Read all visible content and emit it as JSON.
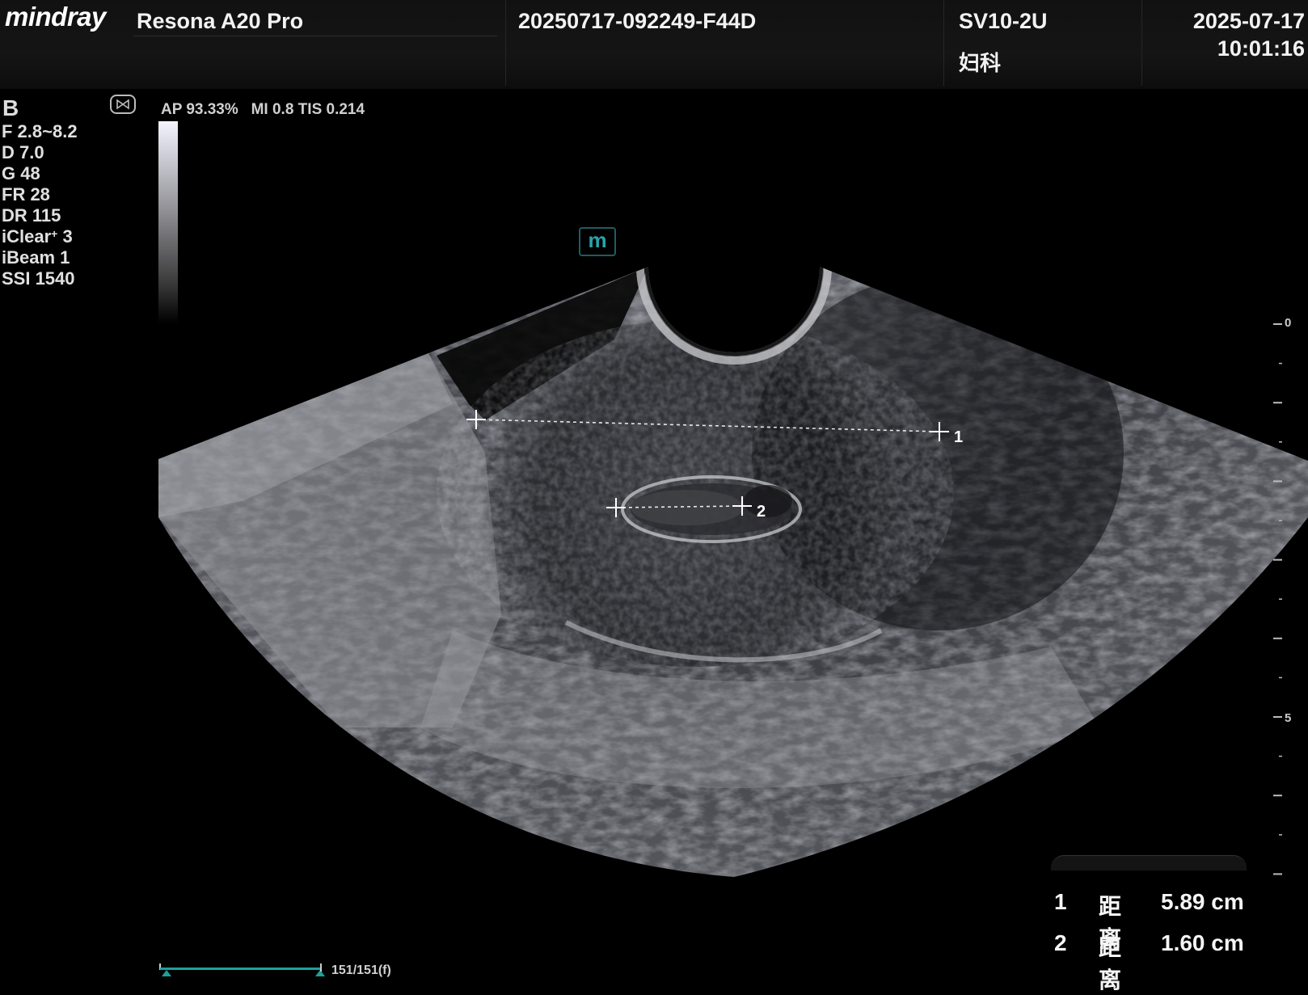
{
  "header": {
    "logo": "mindray",
    "model": "Resona A20 Pro",
    "patient_id": "20250717-092249-F44D",
    "probe": "SV10-2U",
    "exam": "妇科",
    "date": "2025-07-17",
    "time": "10:01:16"
  },
  "image_params": {
    "mode": "B",
    "items": [
      {
        "label": "F 2.8~8.2"
      },
      {
        "label": "D 7.0"
      },
      {
        "label": "G 48"
      },
      {
        "label": "FR 28"
      },
      {
        "label": "DR 115"
      },
      {
        "label": "iClear",
        "sup": "+",
        "value": " 3"
      },
      {
        "label": "iBeam 1"
      },
      {
        "label": "SSI 1540"
      }
    ]
  },
  "acoustic_output": "AP 93.33%   MI 0.8 TIS 0.214",
  "marker_label": "m",
  "depth_scale": {
    "labels": [
      "0",
      "5"
    ]
  },
  "measurements": [
    {
      "index": "1",
      "name": "距离",
      "value": "5.89 cm"
    },
    {
      "index": "2",
      "name": "距离",
      "value": "1.60 cm"
    }
  ],
  "caliper_labels": [
    "1",
    "2"
  ],
  "cine": {
    "counter": "151/151(f)",
    "position": 1.0
  },
  "colors": {
    "accent": "#1aa29a",
    "marker": "#2aa3a8"
  }
}
